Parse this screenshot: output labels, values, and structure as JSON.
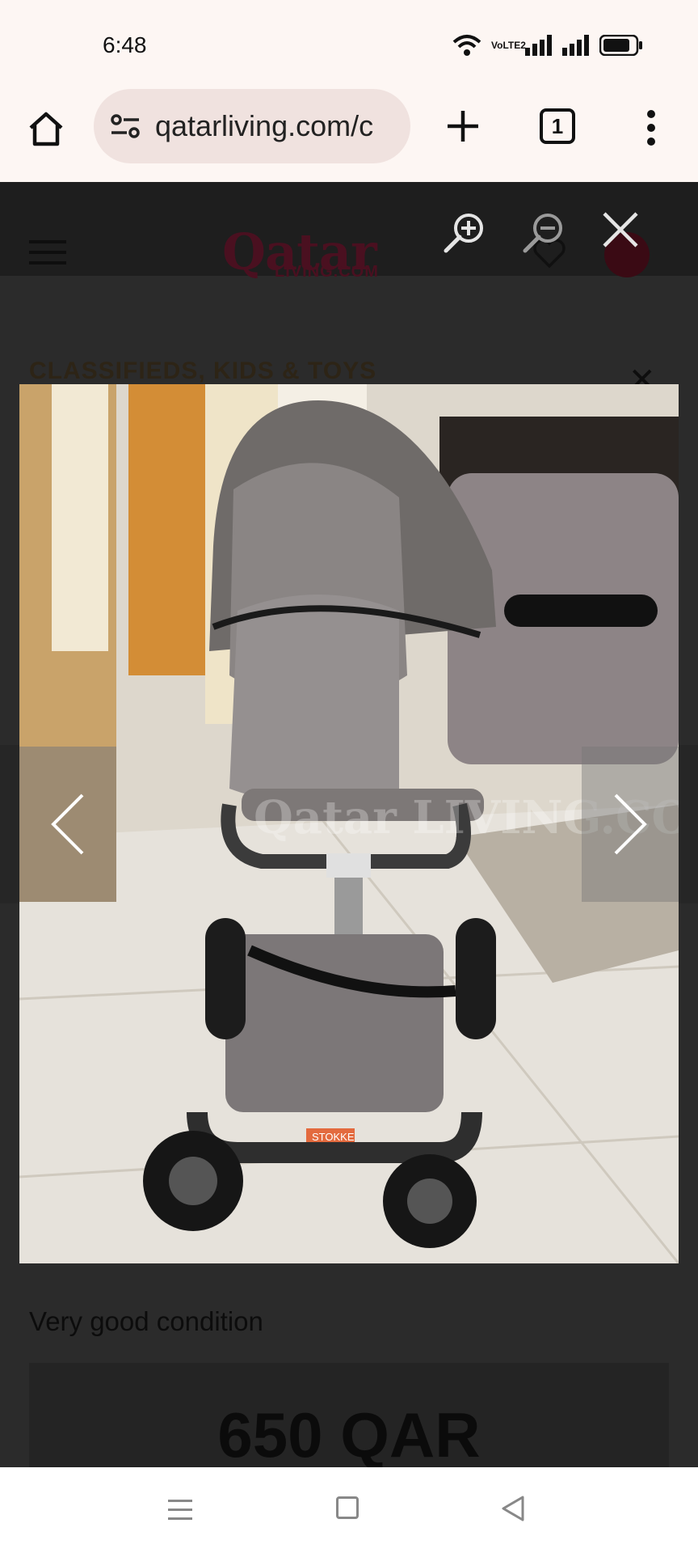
{
  "status_bar": {
    "time": "6:48",
    "volte_label": "VoLTE2",
    "icons": [
      "wifi-icon",
      "volte-icon",
      "signal-icon",
      "signal-icon",
      "battery-icon"
    ]
  },
  "browser": {
    "url": "qatarliving.com/c",
    "tab_count": "1",
    "icons": [
      "home-icon",
      "site-settings-icon",
      "plus-icon",
      "more-vert-icon"
    ]
  },
  "site": {
    "logo": "Qatar",
    "logo_sub": "LIVING.COM",
    "category": "CLASSIFIEDS, KIDS & TOYS"
  },
  "listing": {
    "description": "Very good condition",
    "price": "650 QAR",
    "photo_brand_tag": "STOKKE",
    "watermark": "Qatar LIVING.COM"
  },
  "lightbox": {
    "icons": [
      "zoom-in-icon",
      "zoom-out-icon",
      "close-icon",
      "chevron-left-icon",
      "chevron-right-icon"
    ]
  },
  "nav_bar": {
    "icons": [
      "recents-icon",
      "home-square-icon",
      "back-triangle-icon"
    ]
  },
  "colors": {
    "status_bg": "#fdf6f3",
    "url_pill": "#f0e2df",
    "overlay": "#2b2b2b",
    "brand": "#4a1020"
  }
}
